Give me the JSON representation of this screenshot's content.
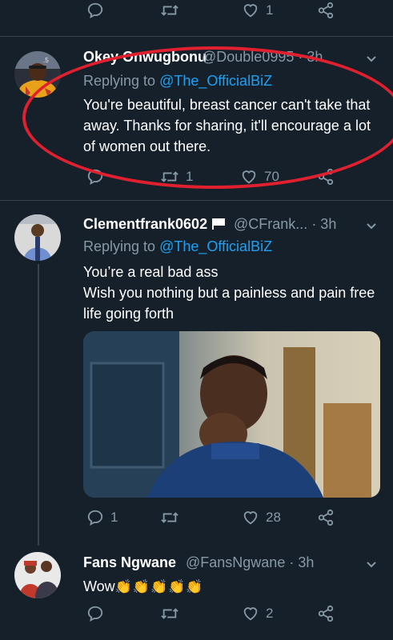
{
  "top_actions": {
    "like_count": "1"
  },
  "tweet1": {
    "name": "Okey Onwugbonu",
    "handle": "@Double0995",
    "time": "3h",
    "replying_prefix": "Replying to",
    "replying_to": "@The_OfficialBiZ",
    "text": "You're beautiful, breast cancer can't take that away. Thanks for sharing, it'll encourage a lot of women out there.",
    "retweet_count": "1",
    "like_count": "70"
  },
  "tweet2": {
    "name": "Clementfrank0602",
    "handle": "@CFrank...",
    "time": "· 3h",
    "replying_prefix": "Replying to",
    "replying_to": "@The_OfficialBiZ",
    "text_line1": "You’re a real bad ass",
    "text_line2": "Wish you nothing but a painless and pain free life going forth",
    "reply_count": "1",
    "like_count": "28"
  },
  "tweet3": {
    "name": "Fans Ngwane",
    "handle": "@FansNgwane",
    "time": "· 3h",
    "text": "Wow",
    "emoji": "👏👏👏👏👏",
    "like_count": "2"
  },
  "colors": {
    "background": "#15202b",
    "secondary_text": "#8899a6",
    "accent": "#1da1f2",
    "annotation": "#e0202f"
  },
  "icons": [
    "reply-icon",
    "retweet-icon",
    "like-icon",
    "share-icon",
    "chevron-down-icon",
    "flag-icon"
  ]
}
